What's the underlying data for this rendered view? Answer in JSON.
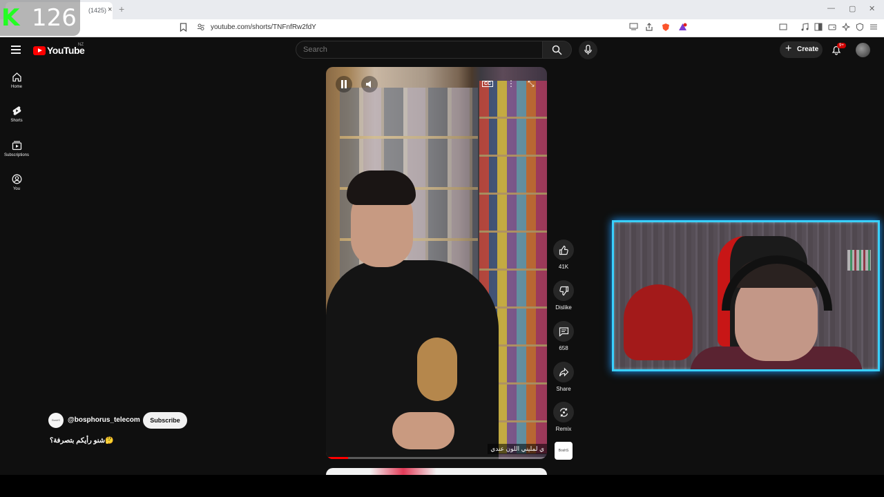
{
  "browser": {
    "tab_title": "(1425)",
    "tab_close": "×",
    "new_tab": "+",
    "url": "youtube.com/shorts/TNFnfRw2fdY",
    "window_controls": [
      "—",
      "▢",
      "✕"
    ]
  },
  "overlay": {
    "letter": "K",
    "counter": "126",
    "accent_color": "#22ff22"
  },
  "header": {
    "logo_text": "YouTube",
    "region": "NZ",
    "search_placeholder": "Search",
    "create_label": "Create",
    "create_icon": "plus-icon",
    "notification_badge": "9+",
    "brand_color": "#ff0000"
  },
  "sidebar": {
    "items": [
      {
        "label": "Home",
        "icon": "home-icon"
      },
      {
        "label": "Shorts",
        "icon": "shorts-icon"
      },
      {
        "label": "Subscriptions",
        "icon": "subscriptions-icon"
      },
      {
        "label": "You",
        "icon": "you-icon"
      }
    ]
  },
  "video": {
    "cc_label": "CC",
    "subtitle_text": "ي لمليني اللون عندي",
    "progress": 0.1,
    "progress_color": "#ff0000"
  },
  "actions": {
    "like_count": "41K",
    "dislike_label": "Dislike",
    "comments_count": "658",
    "share_label": "Share",
    "remix_label": "Remix",
    "sound_thumb_text": "BoshS"
  },
  "channel": {
    "handle": "@bosphorus_telecom",
    "avatar_text": "BoshS",
    "subscribe_label": "Subscribe",
    "caption": "شنو رأيكم بتصرفة؟🤔"
  },
  "webcam": {
    "frame_color": "#39d0ff"
  }
}
